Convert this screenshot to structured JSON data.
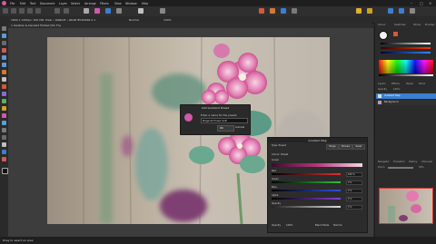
{
  "menu": {
    "items": [
      "File",
      "Edit",
      "Text",
      "Document",
      "Layer",
      "Select",
      "Arrange",
      "Filters",
      "View",
      "Window",
      "Help"
    ]
  },
  "document_tab": {
    "title": "1 Sanitize & blended fiddled (54.7%)"
  },
  "context_bar": {
    "info": "1800 x 1200px, 300 DPI, Pixel • RGBA/8 • sRGB IEC61966-2.1",
    "mode": "Normal",
    "opacity": "100%"
  },
  "dialog": {
    "title": "Add Gradient Preset",
    "label": "Enter a name for the preset:",
    "value": "Magenta Flower Soft",
    "ok_label": "OK",
    "cancel_label": "Cancel"
  },
  "gradient_map": {
    "title": "Gradient Map",
    "preset_label": "Type: Preset",
    "buttons": [
      "Merge",
      "Preview",
      "Reset"
    ],
    "color_label": "Colour: Preset",
    "gradient_type": "Linear",
    "sliders": [
      {
        "label": "Red",
        "value": "100 %"
      },
      {
        "label": "Green",
        "value": "0 %"
      },
      {
        "label": "Blue",
        "value": "0 %"
      },
      {
        "label": "Alpha",
        "value": "0 %"
      },
      {
        "label": "Opacity",
        "value": "0 %"
      }
    ],
    "opacity_label": "Opacity",
    "opacity_value": "100%",
    "blend_label": "Blend Mode",
    "blend_value": "Normal"
  },
  "right_panel": {
    "tabs_top": [
      "Colour",
      "Swatches",
      "Stroke",
      "Brushes"
    ],
    "tabs_mid": [
      "Layers",
      "Effects",
      "Styles",
      "Stock"
    ],
    "opacity_label": "Opacity",
    "opacity_value": "100%",
    "layers": [
      {
        "name": "Gradient Map",
        "selected": true
      },
      {
        "name": "Background",
        "selected": false
      }
    ],
    "tabs_bottom": [
      "Navigator",
      "Transform",
      "History",
      "Channels"
    ],
    "zoom_label": "Zoom",
    "zoom_value": "54%"
  },
  "status_bar": {
    "text": "Drag to select an area"
  },
  "colors": {
    "accent": "#3b7fd0",
    "brand": "#d15aa8"
  }
}
